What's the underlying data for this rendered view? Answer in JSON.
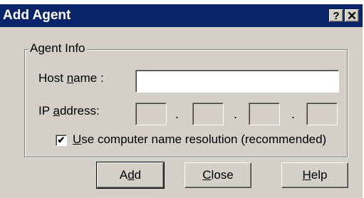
{
  "window": {
    "title": "Add Agent",
    "help_glyph": "?",
    "close_glyph": "✕"
  },
  "group": {
    "label": "Agent Info"
  },
  "host_name": {
    "label_pre": "Host ",
    "label_accel": "n",
    "label_post": "ame :",
    "value": ""
  },
  "ip_address": {
    "label_pre": "IP ",
    "label_accel": "a",
    "label_post": "ddress:",
    "dot": "."
  },
  "resolution": {
    "checked": true,
    "check_glyph": "✔",
    "label_accel": "U",
    "label_post": "se computer name resolution  (recommended)"
  },
  "buttons": {
    "add": {
      "pre": "A",
      "accel": "d",
      "post": "d"
    },
    "close": {
      "pre": "",
      "accel": "C",
      "post": "lose"
    },
    "help": {
      "pre": "",
      "accel": "H",
      "post": "elp"
    }
  }
}
